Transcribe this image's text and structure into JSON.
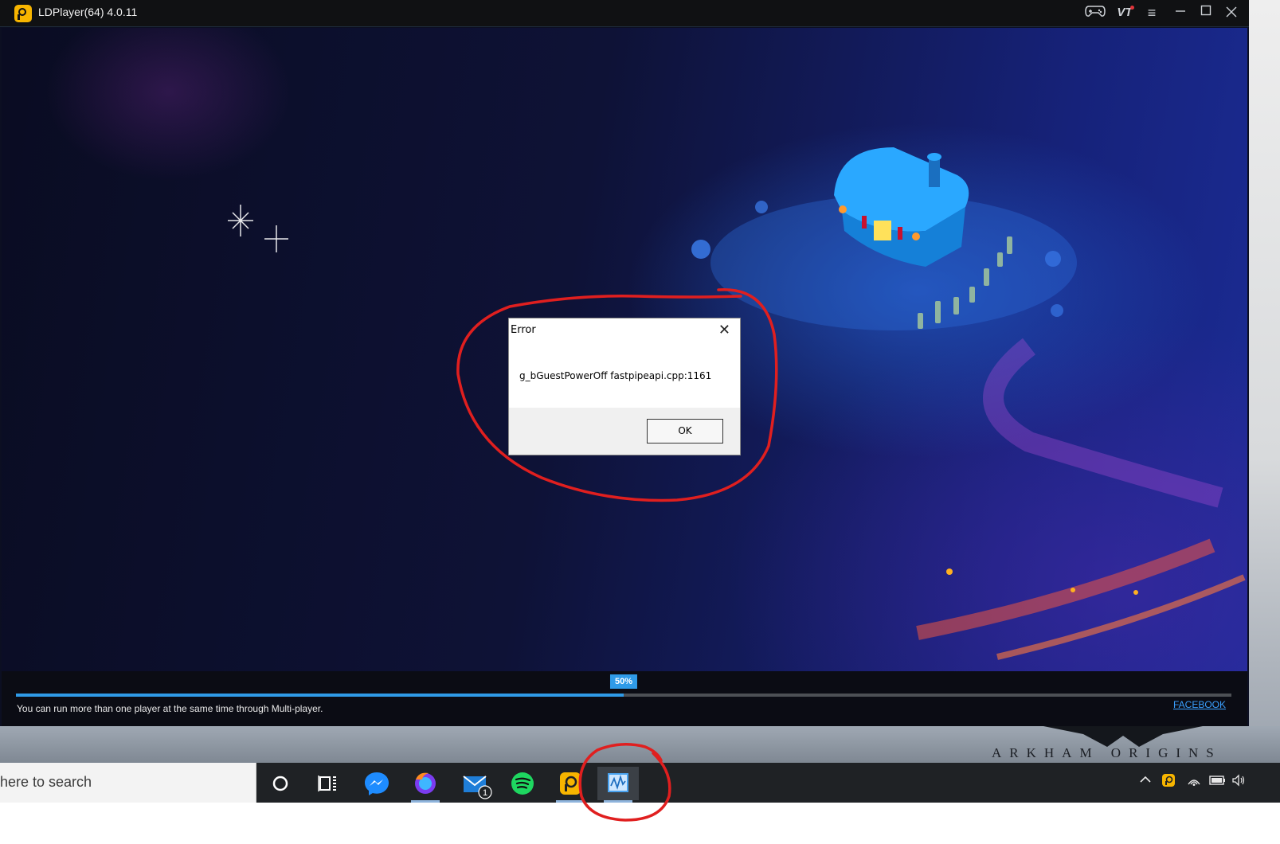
{
  "window": {
    "title": "LDPlayer(64) 4.0.11",
    "controls": {
      "vt": "VT"
    }
  },
  "dialog": {
    "title": "Error",
    "message": "g_bGuestPowerOff fastpipeapi.cpp:1161",
    "ok_label": "OK",
    "close_glyph": "✕"
  },
  "loading": {
    "progress_fraction": 0.5,
    "percent_label": "50%",
    "tip": "You can run more than one player at the same time through Multi-player.",
    "facebook_label": "FACEBOOK"
  },
  "desktop": {
    "wallpaper_text": "ARKHAM ORIGINS"
  },
  "taskbar": {
    "search_placeholder": "here to search",
    "apps": [
      {
        "name": "cortana-icon"
      },
      {
        "name": "task-view-icon"
      },
      {
        "name": "messenger-icon"
      },
      {
        "name": "firefox-icon"
      },
      {
        "name": "mail-icon",
        "badge": "1"
      },
      {
        "name": "spotify-icon"
      },
      {
        "name": "ldplayer-icon"
      },
      {
        "name": "ldmultiplayer-icon"
      }
    ]
  },
  "colors": {
    "accent": "#2f9be8",
    "annotation": "#e01f1f",
    "titlebar": "#101113",
    "taskbar": "#1f2225"
  }
}
